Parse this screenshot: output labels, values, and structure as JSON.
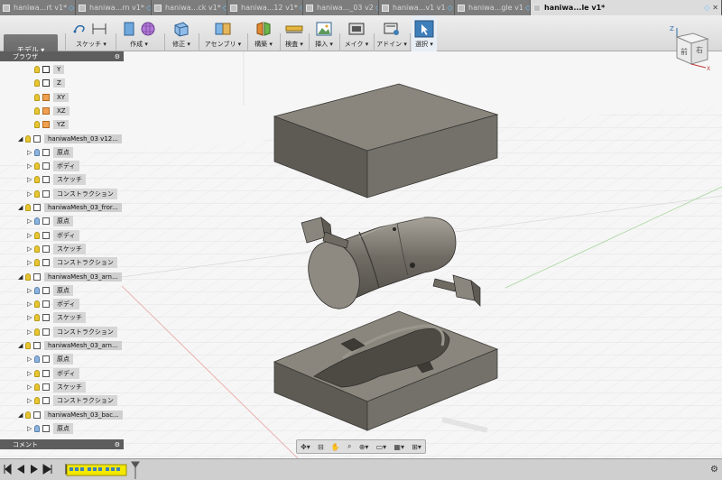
{
  "tabs": [
    {
      "label": "haniwa...rt v1*",
      "active": false
    },
    {
      "label": "haniwa...rn v1*",
      "active": false
    },
    {
      "label": "haniwa...ck v1*",
      "active": false
    },
    {
      "label": "haniwa...12 v1*",
      "active": false
    },
    {
      "label": "haniwa..._03 v2",
      "active": false
    },
    {
      "label": "haniwa...v1 v1",
      "active": false
    },
    {
      "label": "haniwa...gle v1",
      "active": false
    },
    {
      "label": "haniwa...le v1*",
      "active": true
    }
  ],
  "toolbar": {
    "workspace": "モデル ▾",
    "groups": [
      {
        "label": "スケッチ ▾"
      },
      {
        "label": "作成 ▾"
      },
      {
        "label": "修正 ▾"
      },
      {
        "label": "アセンブリ ▾"
      },
      {
        "label": "構築 ▾"
      },
      {
        "label": "検査 ▾"
      },
      {
        "label": "挿入 ▾"
      },
      {
        "label": "メイク ▾"
      },
      {
        "label": "アドイン ▾"
      },
      {
        "label": "選択 ▾"
      }
    ]
  },
  "browser": {
    "title": "ブラウザ",
    "rows": [
      {
        "label": "Y",
        "indent": 2,
        "icon": "axis",
        "tri": false,
        "blue": false
      },
      {
        "label": "Z",
        "indent": 2,
        "icon": "axis",
        "tri": false,
        "blue": false
      },
      {
        "label": "XY",
        "indent": 2,
        "icon": "plane",
        "tri": false,
        "blue": false
      },
      {
        "label": "XZ",
        "indent": 2,
        "icon": "plane",
        "tri": false,
        "blue": false
      },
      {
        "label": "YZ",
        "indent": 2,
        "icon": "plane",
        "tri": false,
        "blue": false
      },
      {
        "label": "haniwaMesh_03 v12...",
        "indent": 1,
        "icon": "comp",
        "tri": "◢",
        "blue": false
      },
      {
        "label": "原点",
        "indent": 2,
        "icon": "folder",
        "tri": "▷",
        "blue": true
      },
      {
        "label": "ボディ",
        "indent": 2,
        "icon": "folder",
        "tri": "▷",
        "blue": false
      },
      {
        "label": "スケッチ",
        "indent": 2,
        "icon": "folder",
        "tri": "▷",
        "blue": false
      },
      {
        "label": "コンストラクション",
        "indent": 2,
        "icon": "folder",
        "tri": "▷",
        "blue": false
      },
      {
        "label": "haniwaMesh_03_fror...",
        "indent": 1,
        "icon": "comp",
        "tri": "◢",
        "blue": false
      },
      {
        "label": "原点",
        "indent": 2,
        "icon": "folder",
        "tri": "▷",
        "blue": true
      },
      {
        "label": "ボディ",
        "indent": 2,
        "icon": "folder",
        "tri": "▷",
        "blue": false
      },
      {
        "label": "スケッチ",
        "indent": 2,
        "icon": "folder",
        "tri": "▷",
        "blue": false
      },
      {
        "label": "コンストラクション",
        "indent": 2,
        "icon": "folder",
        "tri": "▷",
        "blue": false
      },
      {
        "label": "haniwaMesh_03_arn...",
        "indent": 1,
        "icon": "comp",
        "tri": "◢",
        "blue": false
      },
      {
        "label": "原点",
        "indent": 2,
        "icon": "folder",
        "tri": "▷",
        "blue": true
      },
      {
        "label": "ボディ",
        "indent": 2,
        "icon": "folder",
        "tri": "▷",
        "blue": false
      },
      {
        "label": "スケッチ",
        "indent": 2,
        "icon": "folder",
        "tri": "▷",
        "blue": false
      },
      {
        "label": "コンストラクション",
        "indent": 2,
        "icon": "folder",
        "tri": "▷",
        "blue": false
      },
      {
        "label": "haniwaMesh_03_arn...",
        "indent": 1,
        "icon": "comp",
        "tri": "◢",
        "blue": false
      },
      {
        "label": "原点",
        "indent": 2,
        "icon": "folder",
        "tri": "▷",
        "blue": true
      },
      {
        "label": "ボディ",
        "indent": 2,
        "icon": "folder",
        "tri": "▷",
        "blue": false
      },
      {
        "label": "スケッチ",
        "indent": 2,
        "icon": "folder",
        "tri": "▷",
        "blue": false
      },
      {
        "label": "コンストラクション",
        "indent": 2,
        "icon": "folder",
        "tri": "▷",
        "blue": false
      },
      {
        "label": "haniwaMesh_03_bac...",
        "indent": 1,
        "icon": "comp",
        "tri": "◢",
        "blue": false
      },
      {
        "label": "原点",
        "indent": 2,
        "icon": "folder",
        "tri": "▷",
        "blue": true
      }
    ]
  },
  "comment": {
    "title": "コメント"
  },
  "viewcube": {
    "front": "前",
    "right": "右",
    "axis_z": "Z",
    "axis_x": "X"
  },
  "colors": {
    "accent": "#3f7fb9",
    "part": "#7e7a72",
    "grid": "#d8d8d8"
  }
}
